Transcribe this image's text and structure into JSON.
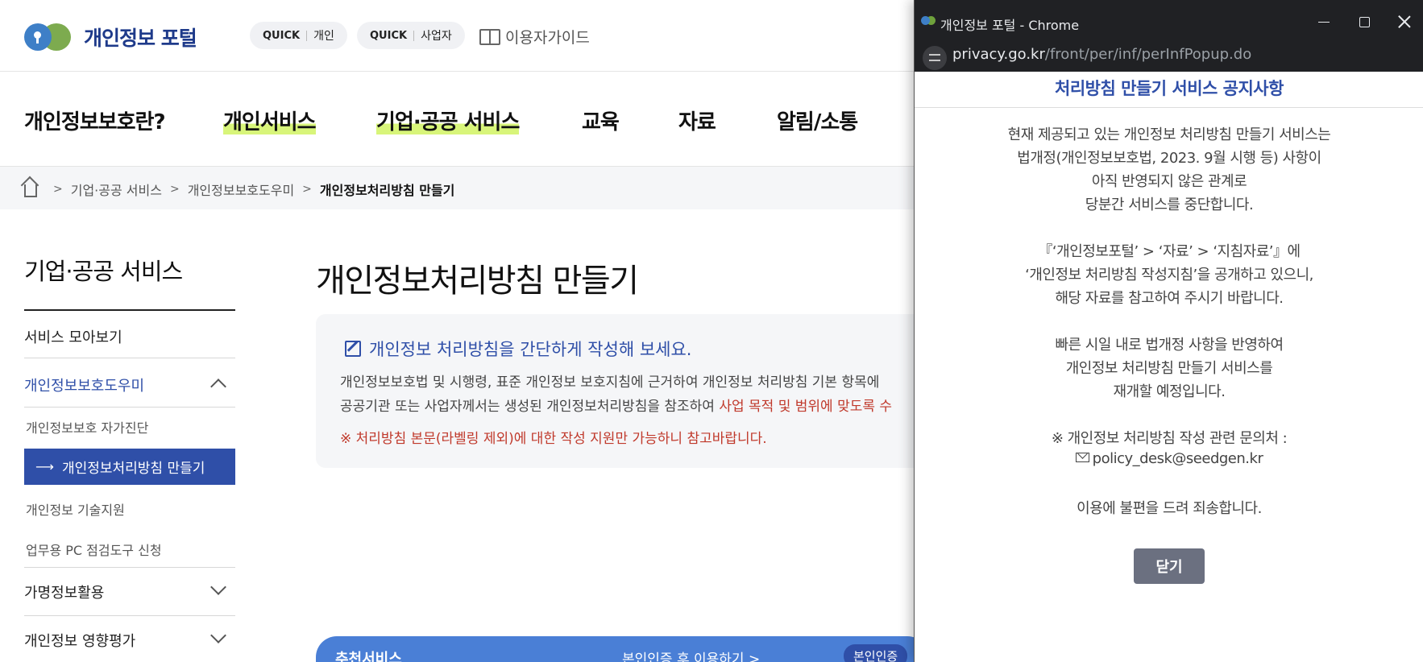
{
  "site": {
    "logo_text": "개인정보 포털",
    "quick_personal": {
      "prefix": "QUICK",
      "label": "개인"
    },
    "quick_business": {
      "prefix": "QUICK",
      "label": "사업자"
    },
    "guide_label": "이용자가이드"
  },
  "gnb": [
    {
      "label": "개인정보보호란?"
    },
    {
      "label": "개인서비스"
    },
    {
      "label": "기업·공공 서비스"
    },
    {
      "label": "교육"
    },
    {
      "label": "자료"
    },
    {
      "label": "알림/소통"
    }
  ],
  "breadcrumb": [
    "기업·공공 서비스",
    "개인정보보호도우미",
    "개인정보처리방침 만들기"
  ],
  "sidebar": {
    "title": "기업·공공 서비스",
    "items": [
      {
        "label": "서비스 모아보기"
      },
      {
        "label": "개인정보보호도우미"
      },
      {
        "label": "개인정보보호 자가진단"
      },
      {
        "label": "개인정보처리방침 만들기"
      },
      {
        "label": "개인정보 기술지원"
      },
      {
        "label": "업무용 PC 점검도구 신청"
      },
      {
        "label": "가명정보활용"
      },
      {
        "label": "개인정보 영향평가"
      }
    ]
  },
  "main": {
    "title": "개인정보처리방침 만들기",
    "info_heading": "개인정보 처리방침을 간단하게 작성해 보세요.",
    "info_line1": "개인정보보호법 및 시행령, 표준 개인정보 보호지침에 근거하여 개인정보 처리방침 기본 항목에",
    "info_line2_a": "공공기관 또는 사업자께서는 생성된 개인정보처리방침을 참조하여 ",
    "info_line2_b": "사업 목적 및 범위에 맞도록 수",
    "info_note": "※ 처리방침 본문(라벨링 제외)에 대한 작성 지원만 가능하니 참고바랍니다.",
    "banner_left": "추천서비스",
    "banner_mid": "본인인증 후 이용하기 >",
    "banner_right": "본인인증"
  },
  "popup": {
    "window_title": "개인정보 포털 - Chrome",
    "url_domain": "privacy.go.kr",
    "url_path": "/front/per/inf/perInfPopup.do",
    "title": "처리방침 만들기 서비스 공지사항",
    "lines": [
      "현재 제공되고 있는 개인정보 처리방침 만들기 서비스는",
      "법개정(개인정보보호법, 2023. 9월 시행 등) 사항이",
      "아직 반영되지 않은 관계로",
      "당분간 서비스를 중단합니다.",
      "『‘개인정보포털’ > ‘자료’ > ‘지침자료’』에",
      "‘개인정보 처리방침 작성지침’을 공개하고 있으니,",
      "해당 자료를 참고하여 주시기 바랍니다.",
      "빠른 시일 내로 법개정 사항을 반영하여",
      "개인정보 처리방침 만들기 서비스를",
      "재개할 예정입니다.",
      "※ 개인정보 처리방침 작성 관련 문의처 :",
      "policy_desk@seedgen.kr",
      "이용에 불편을 드려 죄송합니다."
    ],
    "close_label": "닫기"
  },
  "colors": {
    "brand_blue": "#2f4fa8",
    "highlight": "#d8f57a",
    "notice_red": "#c0392b",
    "chrome_dark": "#202124"
  }
}
